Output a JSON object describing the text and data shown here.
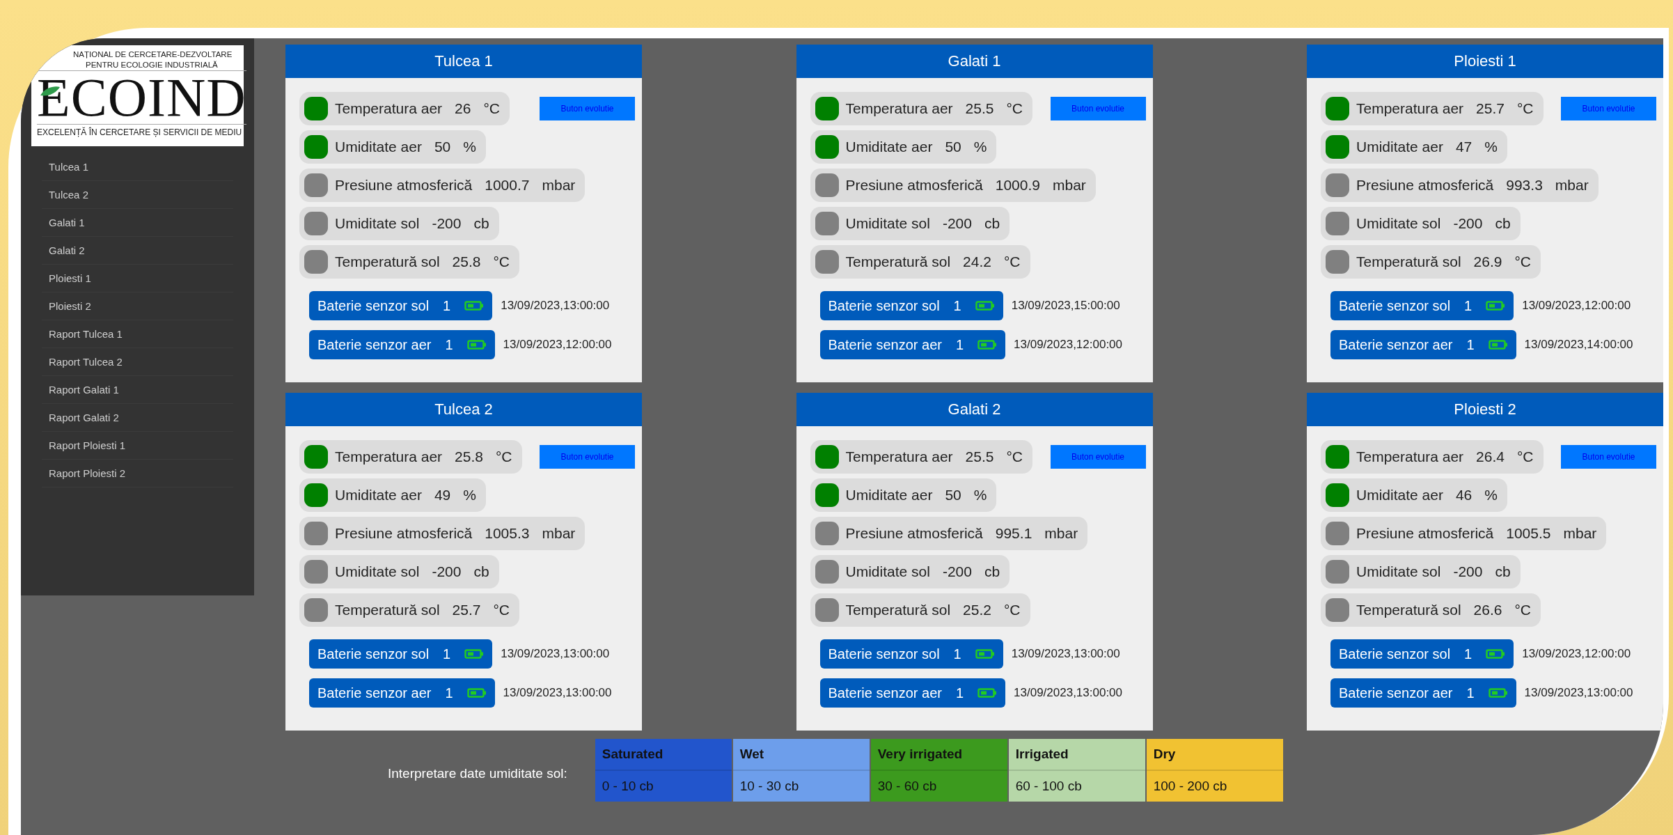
{
  "logo": {
    "line_1": "NAȚIONAL DE CERCETARE-DEZVOLTARE",
    "line_2": "PENTRU ECOLOGIE INDUSTRIALĂ",
    "name": "ECOIND",
    "tagline": "EXCELENȚĂ ÎN CERCETARE ȘI SERVICII DE MEDIU"
  },
  "sidebar": {
    "items": [
      {
        "label": "Tulcea 1"
      },
      {
        "label": "Tulcea 2"
      },
      {
        "label": "Galati 1"
      },
      {
        "label": "Galati 2"
      },
      {
        "label": "Ploiesti 1"
      },
      {
        "label": "Ploiesti 2"
      },
      {
        "label": "Raport Tulcea 1"
      },
      {
        "label": "Raport Tulcea 2"
      },
      {
        "label": "Raport Galati 1"
      },
      {
        "label": "Raport Galati 2"
      },
      {
        "label": "Raport Ploiesti 1"
      },
      {
        "label": "Raport Ploiesti 2"
      }
    ]
  },
  "stations": [
    {
      "title": "Tulcea 1",
      "button": "Buton evolutie",
      "sensors": [
        {
          "label": "Temperatura aer",
          "value": "26",
          "unit": "°C",
          "color": "#008000"
        },
        {
          "label": "Umiditate aer",
          "value": "50",
          "unit": "%",
          "color": "#008000"
        },
        {
          "label": "Presiune atmosferică",
          "value": "1000.7",
          "unit": "mbar",
          "color": "#808080"
        },
        {
          "label": "Umiditate sol",
          "value": "-200",
          "unit": "cb",
          "color": "#808080"
        },
        {
          "label": "Temperatură sol",
          "value": "25.8",
          "unit": "°C",
          "color": "#808080"
        }
      ],
      "batteries": [
        {
          "label": "Baterie senzor sol",
          "value": "1",
          "time": "13/09/2023,13:00:00"
        },
        {
          "label": "Baterie senzor aer",
          "value": "1",
          "time": "13/09/2023,12:00:00"
        }
      ]
    },
    {
      "title": "Galati 1",
      "button": "Buton evolutie",
      "sensors": [
        {
          "label": "Temperatura aer",
          "value": "25.5",
          "unit": "°C",
          "color": "#008000"
        },
        {
          "label": "Umiditate aer",
          "value": "50",
          "unit": "%",
          "color": "#008000"
        },
        {
          "label": "Presiune atmosferică",
          "value": "1000.9",
          "unit": "mbar",
          "color": "#808080"
        },
        {
          "label": "Umiditate sol",
          "value": "-200",
          "unit": "cb",
          "color": "#808080"
        },
        {
          "label": "Temperatură sol",
          "value": "24.2",
          "unit": "°C",
          "color": "#808080"
        }
      ],
      "batteries": [
        {
          "label": "Baterie senzor sol",
          "value": "1",
          "time": "13/09/2023,15:00:00"
        },
        {
          "label": "Baterie senzor aer",
          "value": "1",
          "time": "13/09/2023,12:00:00"
        }
      ]
    },
    {
      "title": "Ploiesti 1",
      "button": "Buton evolutie",
      "sensors": [
        {
          "label": "Temperatura aer",
          "value": "25.7",
          "unit": "°C",
          "color": "#008000"
        },
        {
          "label": "Umiditate aer",
          "value": "47",
          "unit": "%",
          "color": "#008000"
        },
        {
          "label": "Presiune atmosferică",
          "value": "993.3",
          "unit": "mbar",
          "color": "#808080"
        },
        {
          "label": "Umiditate sol",
          "value": "-200",
          "unit": "cb",
          "color": "#808080"
        },
        {
          "label": "Temperatură sol",
          "value": "26.9",
          "unit": "°C",
          "color": "#808080"
        }
      ],
      "batteries": [
        {
          "label": "Baterie senzor sol",
          "value": "1",
          "time": "13/09/2023,12:00:00"
        },
        {
          "label": "Baterie senzor aer",
          "value": "1",
          "time": "13/09/2023,14:00:00"
        }
      ]
    },
    {
      "title": "Tulcea 2",
      "button": "Buton evolutie",
      "sensors": [
        {
          "label": "Temperatura aer",
          "value": "25.8",
          "unit": "°C",
          "color": "#008000"
        },
        {
          "label": "Umiditate aer",
          "value": "49",
          "unit": "%",
          "color": "#008000"
        },
        {
          "label": "Presiune atmosferică",
          "value": "1005.3",
          "unit": "mbar",
          "color": "#808080"
        },
        {
          "label": "Umiditate sol",
          "value": "-200",
          "unit": "cb",
          "color": "#808080"
        },
        {
          "label": "Temperatură sol",
          "value": "25.7",
          "unit": "°C",
          "color": "#808080"
        }
      ],
      "batteries": [
        {
          "label": "Baterie senzor sol",
          "value": "1",
          "time": "13/09/2023,13:00:00"
        },
        {
          "label": "Baterie senzor aer",
          "value": "1",
          "time": "13/09/2023,13:00:00"
        }
      ]
    },
    {
      "title": "Galati 2",
      "button": "Buton evolutie",
      "sensors": [
        {
          "label": "Temperatura aer",
          "value": "25.5",
          "unit": "°C",
          "color": "#008000"
        },
        {
          "label": "Umiditate aer",
          "value": "50",
          "unit": "%",
          "color": "#008000"
        },
        {
          "label": "Presiune atmosferică",
          "value": "995.1",
          "unit": "mbar",
          "color": "#808080"
        },
        {
          "label": "Umiditate sol",
          "value": "-200",
          "unit": "cb",
          "color": "#808080"
        },
        {
          "label": "Temperatură sol",
          "value": "25.2",
          "unit": "°C",
          "color": "#808080"
        }
      ],
      "batteries": [
        {
          "label": "Baterie senzor sol",
          "value": "1",
          "time": "13/09/2023,13:00:00"
        },
        {
          "label": "Baterie senzor aer",
          "value": "1",
          "time": "13/09/2023,13:00:00"
        }
      ]
    },
    {
      "title": "Ploiesti 2",
      "button": "Buton evolutie",
      "sensors": [
        {
          "label": "Temperatura aer",
          "value": "26.4",
          "unit": "°C",
          "color": "#008000"
        },
        {
          "label": "Umiditate aer",
          "value": "46",
          "unit": "%",
          "color": "#008000"
        },
        {
          "label": "Presiune atmosferică",
          "value": "1005.5",
          "unit": "mbar",
          "color": "#808080"
        },
        {
          "label": "Umiditate sol",
          "value": "-200",
          "unit": "cb",
          "color": "#808080"
        },
        {
          "label": "Temperatură sol",
          "value": "26.6",
          "unit": "°C",
          "color": "#808080"
        }
      ],
      "batteries": [
        {
          "label": "Baterie senzor sol",
          "value": "1",
          "time": "13/09/2023,12:00:00"
        },
        {
          "label": "Baterie senzor aer",
          "value": "1",
          "time": "13/09/2023,13:00:00"
        }
      ]
    }
  ],
  "legend": {
    "label": "Interpretare date umiditate sol:",
    "levels": [
      {
        "name": "Saturated",
        "range": "0 - 10 cb",
        "color": "#2255cc"
      },
      {
        "name": "Wet",
        "range": "10 - 30 cb",
        "color": "#6d9eeb"
      },
      {
        "name": "Very irrigated",
        "range": "30 - 60 cb",
        "color": "#3c9a1e"
      },
      {
        "name": "Irrigated",
        "range": "60 - 100 cb",
        "color": "#b6d7a8"
      },
      {
        "name": "Dry",
        "range": "100 - 200 cb",
        "color": "#f1c232"
      }
    ]
  }
}
